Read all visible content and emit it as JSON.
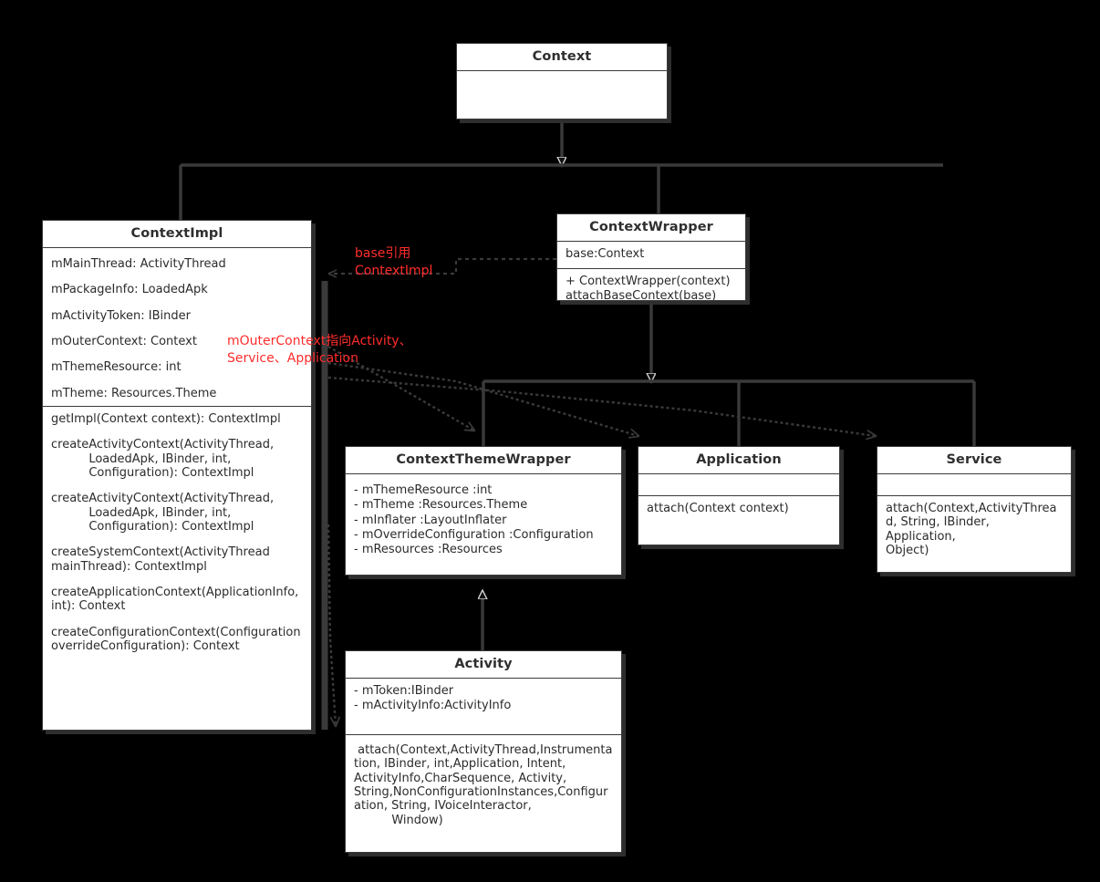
{
  "diagram": {
    "title": "Android Context class hierarchy",
    "background_color": "#000000",
    "line_color": "#3a3a3a",
    "box_fill": "#ffffff",
    "annotation_color": "#ff2d2d"
  },
  "classes": {
    "context": {
      "name": "Context",
      "attributes": [],
      "methods": []
    },
    "context_impl": {
      "name": "ContextImpl",
      "attributes": [
        "mMainThread: ActivityThread",
        "mPackageInfo: LoadedApk",
        "mActivityToken: IBinder",
        "mOuterContext: Context",
        "mThemeResource: int",
        "mTheme: Resources.Theme"
      ],
      "methods": [
        "getImpl(Context context): ContextImpl",
        "createActivityContext(ActivityThread,\n          LoadedApk, IBinder, int,\n          Configuration): ContextImpl",
        "createActivityContext(ActivityThread,\n          LoadedApk, IBinder, int,\n          Configuration): ContextImpl",
        "createSystemContext(ActivityThread\nmainThread): ContextImpl",
        "createApplicationContext(ApplicationInfo,\nint): Context",
        "createConfigurationContext(Configuration\noverrideConfiguration): Context"
      ]
    },
    "context_wrapper": {
      "name": "ContextWrapper",
      "attributes": [
        "base:Context"
      ],
      "methods": [
        "+ ContextWrapper(context)",
        "attachBaseContext(base)"
      ]
    },
    "context_theme_wrapper": {
      "name": "ContextThemeWrapper",
      "attributes": [
        "- mThemeResource :int",
        "- mTheme :Resources.Theme",
        "- mInflater :LayoutInflater",
        "- mOverrideConfiguration :Configuration",
        "- mResources :Resources"
      ],
      "methods": []
    },
    "application": {
      "name": "Application",
      "attributes": [],
      "methods": [
        "attach(Context context)"
      ]
    },
    "service": {
      "name": "Service",
      "attributes": [],
      "methods": [
        "attach(Context,ActivityThrea\nd, String, IBinder, Application,\nObject)"
      ]
    },
    "activity": {
      "name": "Activity",
      "attributes": [
        "- mToken:IBinder",
        "- mActivityInfo:ActivityInfo"
      ],
      "methods": [
        " attach(Context,ActivityThread,Instrumenta\ntion, IBinder, int,Application, Intent,\nActivityInfo,CharSequence, Activity,\nString,NonConfigurationInstances,Configur\nation, String, IVoiceInteractor,\n          Window)"
      ]
    }
  },
  "annotations": [
    {
      "id": "base-ref-note",
      "text": "base引用\nContextImpl",
      "color": "#ff2d2d"
    },
    {
      "id": "outer-context-note",
      "text": "mOuterContext指向Activity、\nService、Application",
      "color": "#ff2d2d"
    }
  ],
  "relationships": [
    {
      "from": "ContextImpl",
      "to": "Context",
      "type": "generalization"
    },
    {
      "from": "ContextWrapper",
      "to": "Context",
      "type": "generalization"
    },
    {
      "from": "ContextThemeWrapper",
      "to": "ContextWrapper",
      "type": "generalization"
    },
    {
      "from": "Application",
      "to": "ContextWrapper",
      "type": "generalization"
    },
    {
      "from": "Service",
      "to": "ContextWrapper",
      "type": "generalization"
    },
    {
      "from": "Activity",
      "to": "ContextThemeWrapper",
      "type": "generalization"
    },
    {
      "from": "ContextWrapper.base",
      "to": "ContextImpl",
      "type": "association"
    },
    {
      "from": "ContextImpl.mOuterContext",
      "to": "ContextThemeWrapper",
      "type": "association"
    },
    {
      "from": "ContextImpl.mOuterContext",
      "to": "Application",
      "type": "association"
    },
    {
      "from": "ContextImpl.mOuterContext",
      "to": "Service",
      "type": "association"
    },
    {
      "from": "ContextImpl.mOuterContext",
      "to": "Activity",
      "type": "association"
    }
  ]
}
